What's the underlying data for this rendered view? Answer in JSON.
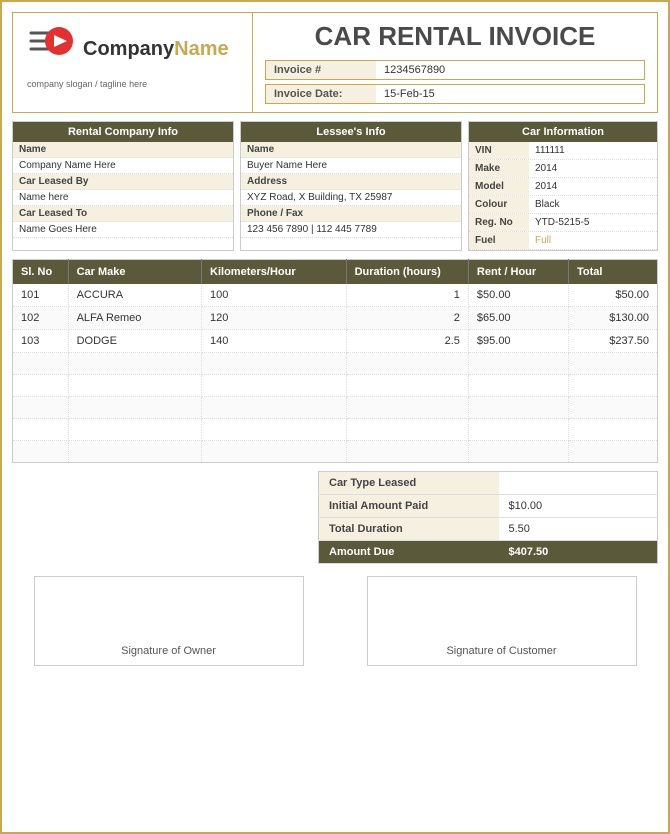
{
  "header": {
    "company_name_part1": "Company",
    "company_name_part2": "Name",
    "slogan": "company slogan / tagline here",
    "invoice_title": "CAR RENTAL INVOICE",
    "invoice_number_label": "Invoice #",
    "invoice_number_value": "1234567890",
    "invoice_date_label": "Invoice Date:",
    "invoice_date_value": "15-Feb-15"
  },
  "rental_company": {
    "header": "Rental Company Info",
    "name_label": "Name",
    "name_value": "Company Name Here",
    "leased_by_label": "Car Leased By",
    "leased_by_value": "Name here",
    "leased_to_label": "Car Leased To",
    "leased_to_value": "Name Goes Here"
  },
  "lessee": {
    "header": "Lessee's Info",
    "name_label": "Name",
    "name_value": "Buyer Name Here",
    "address_label": "Address",
    "address_value": "XYZ Road, X Building, TX 25987",
    "phone_label": "Phone / Fax",
    "phone_value": "123 456 7890 | 112 445 7789"
  },
  "car_info": {
    "header": "Car Information",
    "vin_label": "VIN",
    "vin_value": "111111",
    "make_label": "Make",
    "make_value": "2014",
    "model_label": "Model",
    "model_value": "2014",
    "colour_label": "Colour",
    "colour_value": "Black",
    "regno_label": "Reg. No",
    "regno_value": "YTD-5215-5",
    "fuel_label": "Fuel",
    "fuel_value": "Full"
  },
  "table": {
    "headers": [
      "Sl. No",
      "Car Make",
      "Kilometers/Hour",
      "Duration (hours)",
      "Rent / Hour",
      "Total"
    ],
    "rows": [
      {
        "slno": "101",
        "make": "ACCURA",
        "km": "100",
        "duration": "1",
        "rent": "$50.00",
        "total": "$50.00"
      },
      {
        "slno": "102",
        "make": "ALFA Remeo",
        "km": "120",
        "duration": "2",
        "rent": "$65.00",
        "total": "$130.00"
      },
      {
        "slno": "103",
        "make": "DODGE",
        "km": "140",
        "duration": "2.5",
        "rent": "$95.00",
        "total": "$237.50"
      }
    ],
    "empty_rows": 5
  },
  "summary": {
    "car_type_label": "Car Type Leased",
    "car_type_value": "",
    "initial_amount_label": "Initial Amount Paid",
    "initial_amount_value": "$10.00",
    "total_duration_label": "Total Duration",
    "total_duration_value": "5.50",
    "amount_due_label": "Amount Due",
    "amount_due_value": "$407.50"
  },
  "signatures": {
    "owner_label": "Signature of Owner",
    "customer_label": "Signature of Customer"
  }
}
